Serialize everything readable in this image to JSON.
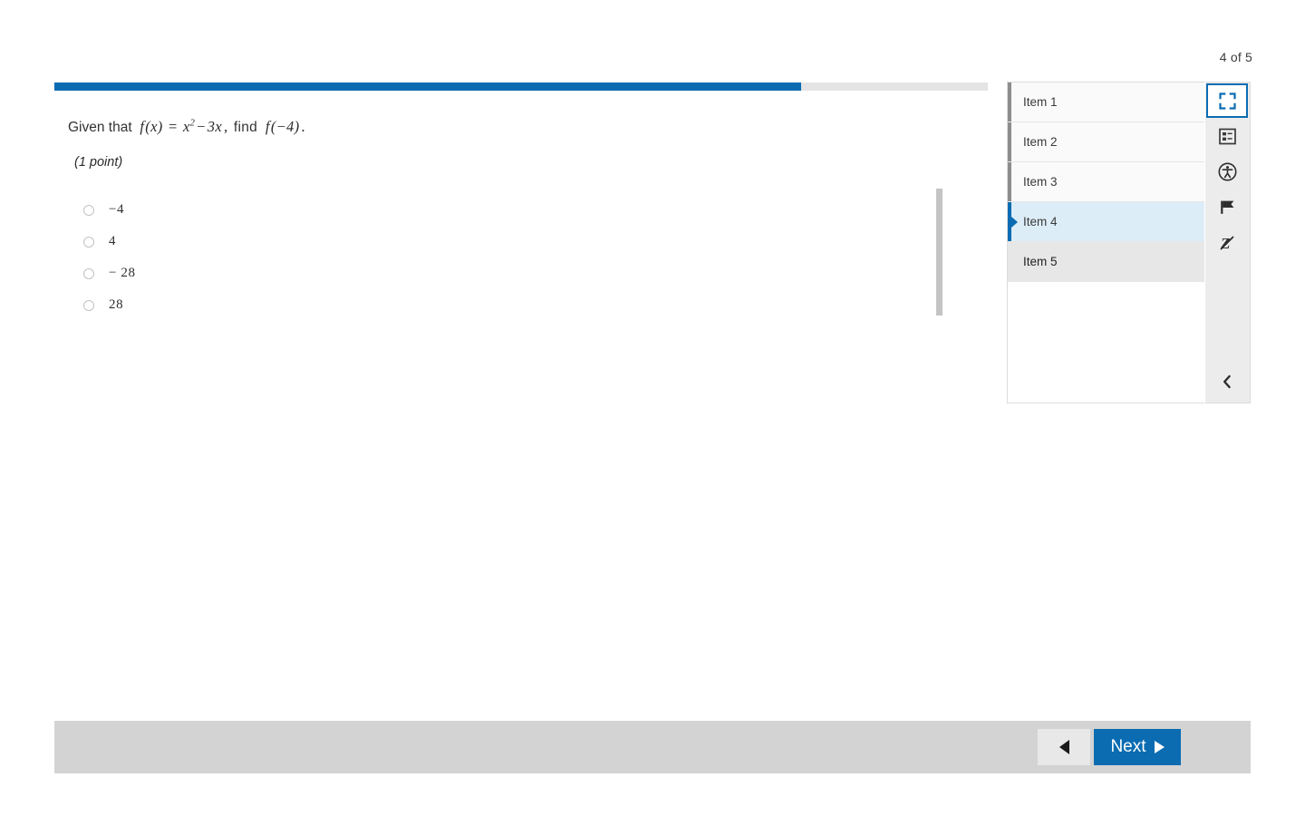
{
  "header": {
    "page_counter": "4 of 5"
  },
  "progress": {
    "percent": 80
  },
  "question": {
    "stem_prefix": "Given that",
    "math": {
      "f": "f",
      "of_x": "(x)",
      "equals": "=",
      "x": "x",
      "exponent": "2",
      "minus": "−",
      "three_x": "3x",
      "comma": ",",
      "find": "find",
      "f2": "f",
      "arg": "(−4)",
      "period": "."
    },
    "points_label": "(1 point)",
    "options": [
      {
        "label": "−4",
        "selected": false
      },
      {
        "label": "4",
        "selected": false
      },
      {
        "label": "− 28",
        "selected": false
      },
      {
        "label": "28",
        "selected": false
      }
    ]
  },
  "item_panel": {
    "items": [
      {
        "label": "Item 1",
        "state": "visited"
      },
      {
        "label": "Item 2",
        "state": "visited"
      },
      {
        "label": "Item 3",
        "state": "visited"
      },
      {
        "label": "Item 4",
        "state": "current"
      },
      {
        "label": "Item 5",
        "state": "hovered"
      }
    ]
  },
  "tool_rail": {
    "tools": [
      {
        "name": "fullscreen-icon",
        "title": "Full screen",
        "active": true
      },
      {
        "name": "item-list-icon",
        "title": "Item list",
        "active": false
      },
      {
        "name": "accessibility-icon",
        "title": "Accessibility",
        "active": false
      },
      {
        "name": "flag-icon",
        "title": "Flag item",
        "active": false
      },
      {
        "name": "answer-eliminator-icon",
        "title": "Answer eliminator",
        "active": false
      }
    ],
    "collapse_title": "Collapse panel"
  },
  "footer": {
    "prev_label": "",
    "next_label": "Next"
  },
  "colors": {
    "accent_blue": "#0b6cb2",
    "current_row": "#dcedf8",
    "footer_gray": "#d3d3d3",
    "rail_gray": "#ececec"
  }
}
